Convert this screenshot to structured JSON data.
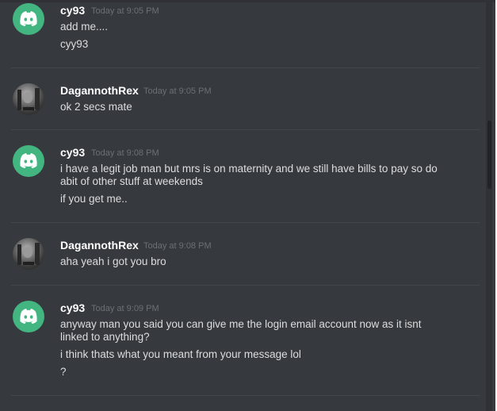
{
  "messages": [
    {
      "author": "cy93",
      "timestamp": "Today at 9:05 PM",
      "lines": [
        "add me....",
        "cyy93"
      ]
    },
    {
      "author": "DagannothRex",
      "timestamp": "Today at 9:05 PM",
      "lines": [
        "ok 2 secs mate"
      ]
    },
    {
      "author": "cy93",
      "timestamp": "Today at 9:08 PM",
      "lines": [
        "i have a legit job man but mrs is on maternity and we still have bills to pay so do abit of other stuff at weekends",
        "if you get me.."
      ]
    },
    {
      "author": "DagannothRex",
      "timestamp": "Today at 9:08 PM",
      "lines": [
        "aha yeah i got you bro"
      ]
    },
    {
      "author": "cy93",
      "timestamp": "Today at 9:09 PM",
      "lines": [
        "anyway man you said you can give me the login email account now as it isnt linked to anything?",
        "i think thats what you meant from your message lol",
        "?"
      ]
    }
  ],
  "colors": {
    "background": "#36393e",
    "discord_avatar": "#43b581",
    "username": "#ffffff",
    "message_text": "#dcddde",
    "timestamp": "#6c6f74"
  },
  "icons": {
    "cy93_avatar": "discord-logo-icon",
    "dagannothrex_avatar": "photo-avatar"
  }
}
